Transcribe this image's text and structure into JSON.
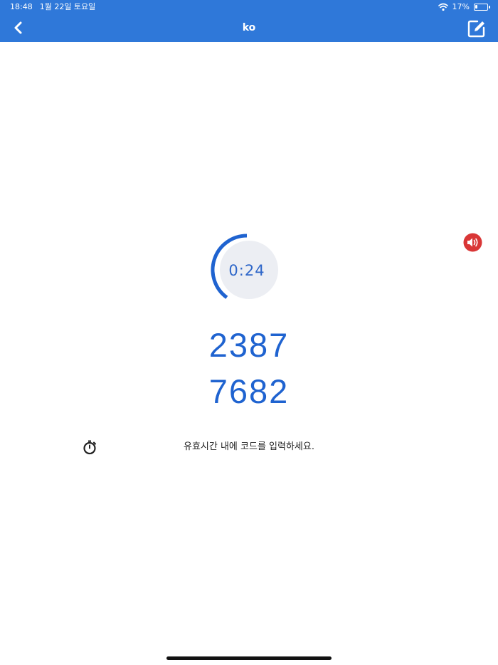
{
  "status_bar": {
    "time": "18:48",
    "date": "1월 22일 토요일",
    "battery_percent": "17%",
    "battery_level": 0.17
  },
  "nav": {
    "title": "ko",
    "back_icon": "chevron-left-icon",
    "edit_icon": "edit-icon"
  },
  "timer": {
    "remaining": "0:24",
    "progress_fraction": 0.4
  },
  "code": {
    "line1": "2387",
    "line2": "7682"
  },
  "instruction": {
    "text": "유효시간 내에 코드를 입력하세요.",
    "icon": "stopwatch-icon"
  },
  "colors": {
    "nav_blue": "#2f78d9",
    "code_blue": "#1f63d0",
    "ring_blue": "#1f63d0",
    "speaker_red": "#d93636"
  }
}
